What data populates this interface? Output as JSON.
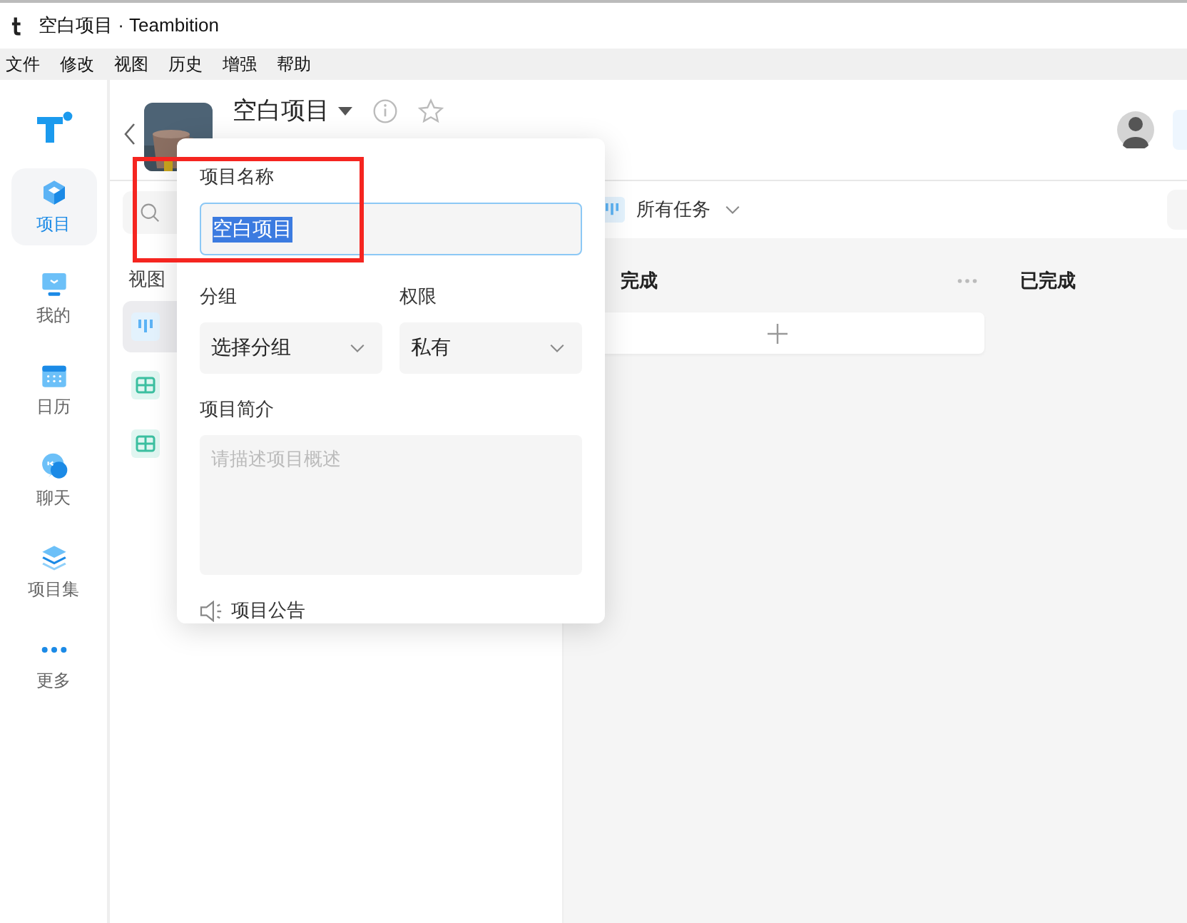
{
  "window": {
    "title": "空白项目 · Teambition"
  },
  "menu": [
    "文件",
    "修改",
    "视图",
    "历史",
    "增强",
    "帮助"
  ],
  "nav": [
    {
      "label": "项目",
      "kind": "cube",
      "selected": true
    },
    {
      "label": "我的",
      "kind": "monitor",
      "selected": false
    },
    {
      "label": "日历",
      "kind": "calendar",
      "selected": false
    },
    {
      "label": "聊天",
      "kind": "chat",
      "selected": false
    },
    {
      "label": "项目集",
      "kind": "layers",
      "selected": false
    },
    {
      "label": "更多",
      "kind": "dots",
      "selected": false
    }
  ],
  "project": {
    "title": "空白项目"
  },
  "views_panel": {
    "heading": "视图",
    "items": [
      {
        "kind": "board",
        "selected": true
      },
      {
        "kind": "table",
        "selected": false
      },
      {
        "kind": "table",
        "selected": false
      }
    ]
  },
  "toolbar": {
    "view": "所有任务"
  },
  "board": {
    "columns": [
      {
        "title": "完成",
        "kind": "open"
      },
      {
        "title": "已完成",
        "kind": "done"
      }
    ]
  },
  "popover": {
    "name_label": "项目名称",
    "name_value": "空白项目",
    "group_label": "分组",
    "group_value": "选择分组",
    "permission_label": "权限",
    "permission_value": "私有",
    "description_label": "项目简介",
    "description_placeholder": "请描述项目概述",
    "announcement": "项目公告"
  }
}
